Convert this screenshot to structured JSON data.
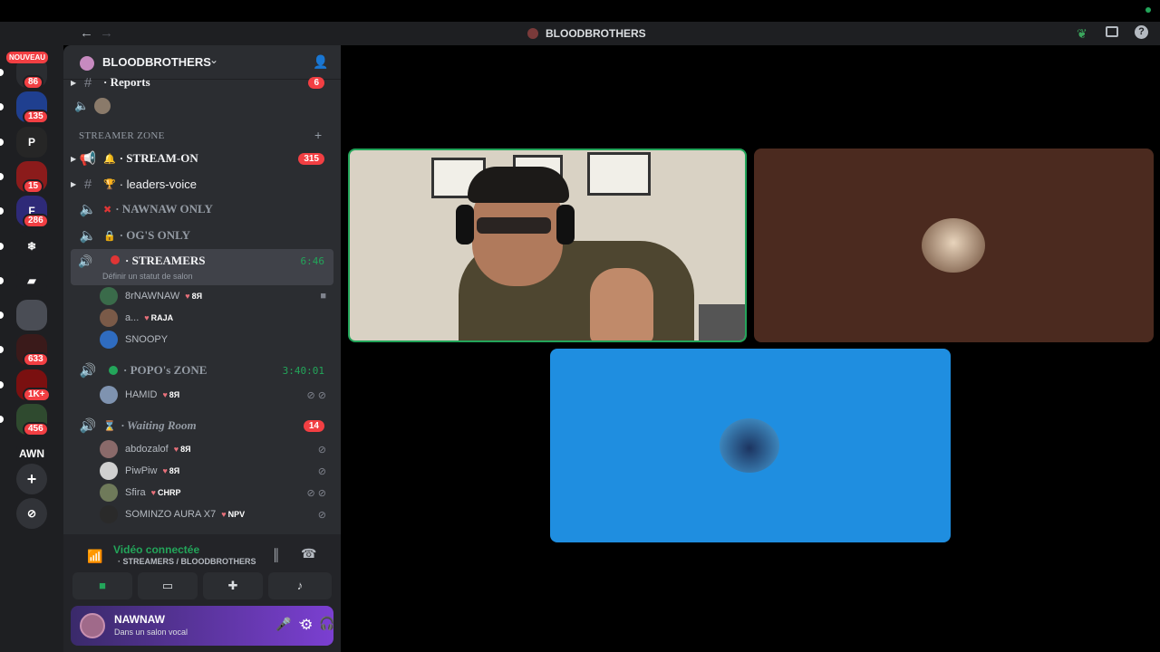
{
  "window": {
    "title": "BLOODBROTHERS",
    "back": "←",
    "forward": "→"
  },
  "rail": {
    "new_badge": "NOUVEAU",
    "servers": [
      {
        "label": "",
        "badge": "86",
        "color": "#2b2d31"
      },
      {
        "label": "",
        "badge": "135",
        "color": "#1f3f8f"
      },
      {
        "label": "P",
        "badge": "",
        "color": "#262626"
      },
      {
        "label": "",
        "badge": "15",
        "color": "#8b1b1b"
      },
      {
        "label": "F",
        "badge": "286",
        "color": "#2e2a78"
      },
      {
        "label": "❄",
        "badge": "",
        "color": "#1e1f22"
      },
      {
        "label": "▰",
        "badge": "",
        "color": "#1e1f22"
      },
      {
        "label": "",
        "badge": "",
        "color": "#4a4d55"
      },
      {
        "label": "",
        "badge": "633",
        "color": "#3a1a1a"
      },
      {
        "label": "",
        "badge": "1K+",
        "color": "#7a1010"
      },
      {
        "label": "",
        "badge": "456",
        "color": "#2f4a2f"
      },
      {
        "label": "AWN",
        "badge": "",
        "color": "#1e1f22"
      }
    ],
    "add_label": "+",
    "explore_label": "⊘"
  },
  "sidebar": {
    "server_name": "BLOODBROTHERS",
    "reports": {
      "name": "· Reports",
      "count": "6"
    },
    "category": "STREAMER ZONE",
    "channels": [
      {
        "name": "· STREAM-ON",
        "count": "315",
        "dim": false,
        "deco": "🔔"
      },
      {
        "name": "· leaders-voice",
        "count": "",
        "dim": false,
        "deco": "🏆"
      },
      {
        "name": "· NAWNAW ONLY",
        "count": "",
        "dim": true,
        "deco": "✖"
      },
      {
        "name": "· OG'S ONLY",
        "count": "",
        "dim": true,
        "deco": "🔒"
      }
    ],
    "streamers": {
      "name": "· STREAMERS",
      "time": "6:46",
      "status": "Définir un statut de salon"
    },
    "streamers_users": [
      {
        "name": "8rNAWNAW",
        "tag": "8Я",
        "avatar": "#3a6b4a"
      },
      {
        "name": "a...",
        "tag": "RAJA",
        "avatar": "#7a5a48"
      },
      {
        "name": "SNOOPY",
        "tag": "",
        "avatar": "#2f6cc0"
      }
    ],
    "popo": {
      "name": "· POPO's ZONE",
      "time": "3:40:01"
    },
    "popo_users": [
      {
        "name": "HAMID",
        "tag": "8Я",
        "avatar": "#7f93b0"
      }
    ],
    "waiting": {
      "name": "· Waiting Room",
      "count": "14"
    },
    "waiting_users": [
      {
        "name": "abdozalof",
        "tag": "8Я",
        "avatar": "#8a6a6a"
      },
      {
        "name": "PiwPiw",
        "tag": "8Я",
        "avatar": "#d0d0d0"
      },
      {
        "name": "Sfira",
        "tag": "CHRP",
        "avatar": "#6f7a5a"
      },
      {
        "name": "SOMINZO AURA X7",
        "tag": "NPV",
        "avatar": "#2a2a2a"
      }
    ]
  },
  "voice_panel": {
    "status": "Vidéo connectée",
    "location": "· STREAMERS / BLOODBROTHERS"
  },
  "user_panel": {
    "name": "NAWNAW",
    "status": "Dans un salon vocal"
  },
  "colors": {
    "accent_green": "#23a55a",
    "tile_brown": "#4b2a1f",
    "tile_blue": "#1f8ee0",
    "user_bar": "#7b3fd1"
  }
}
